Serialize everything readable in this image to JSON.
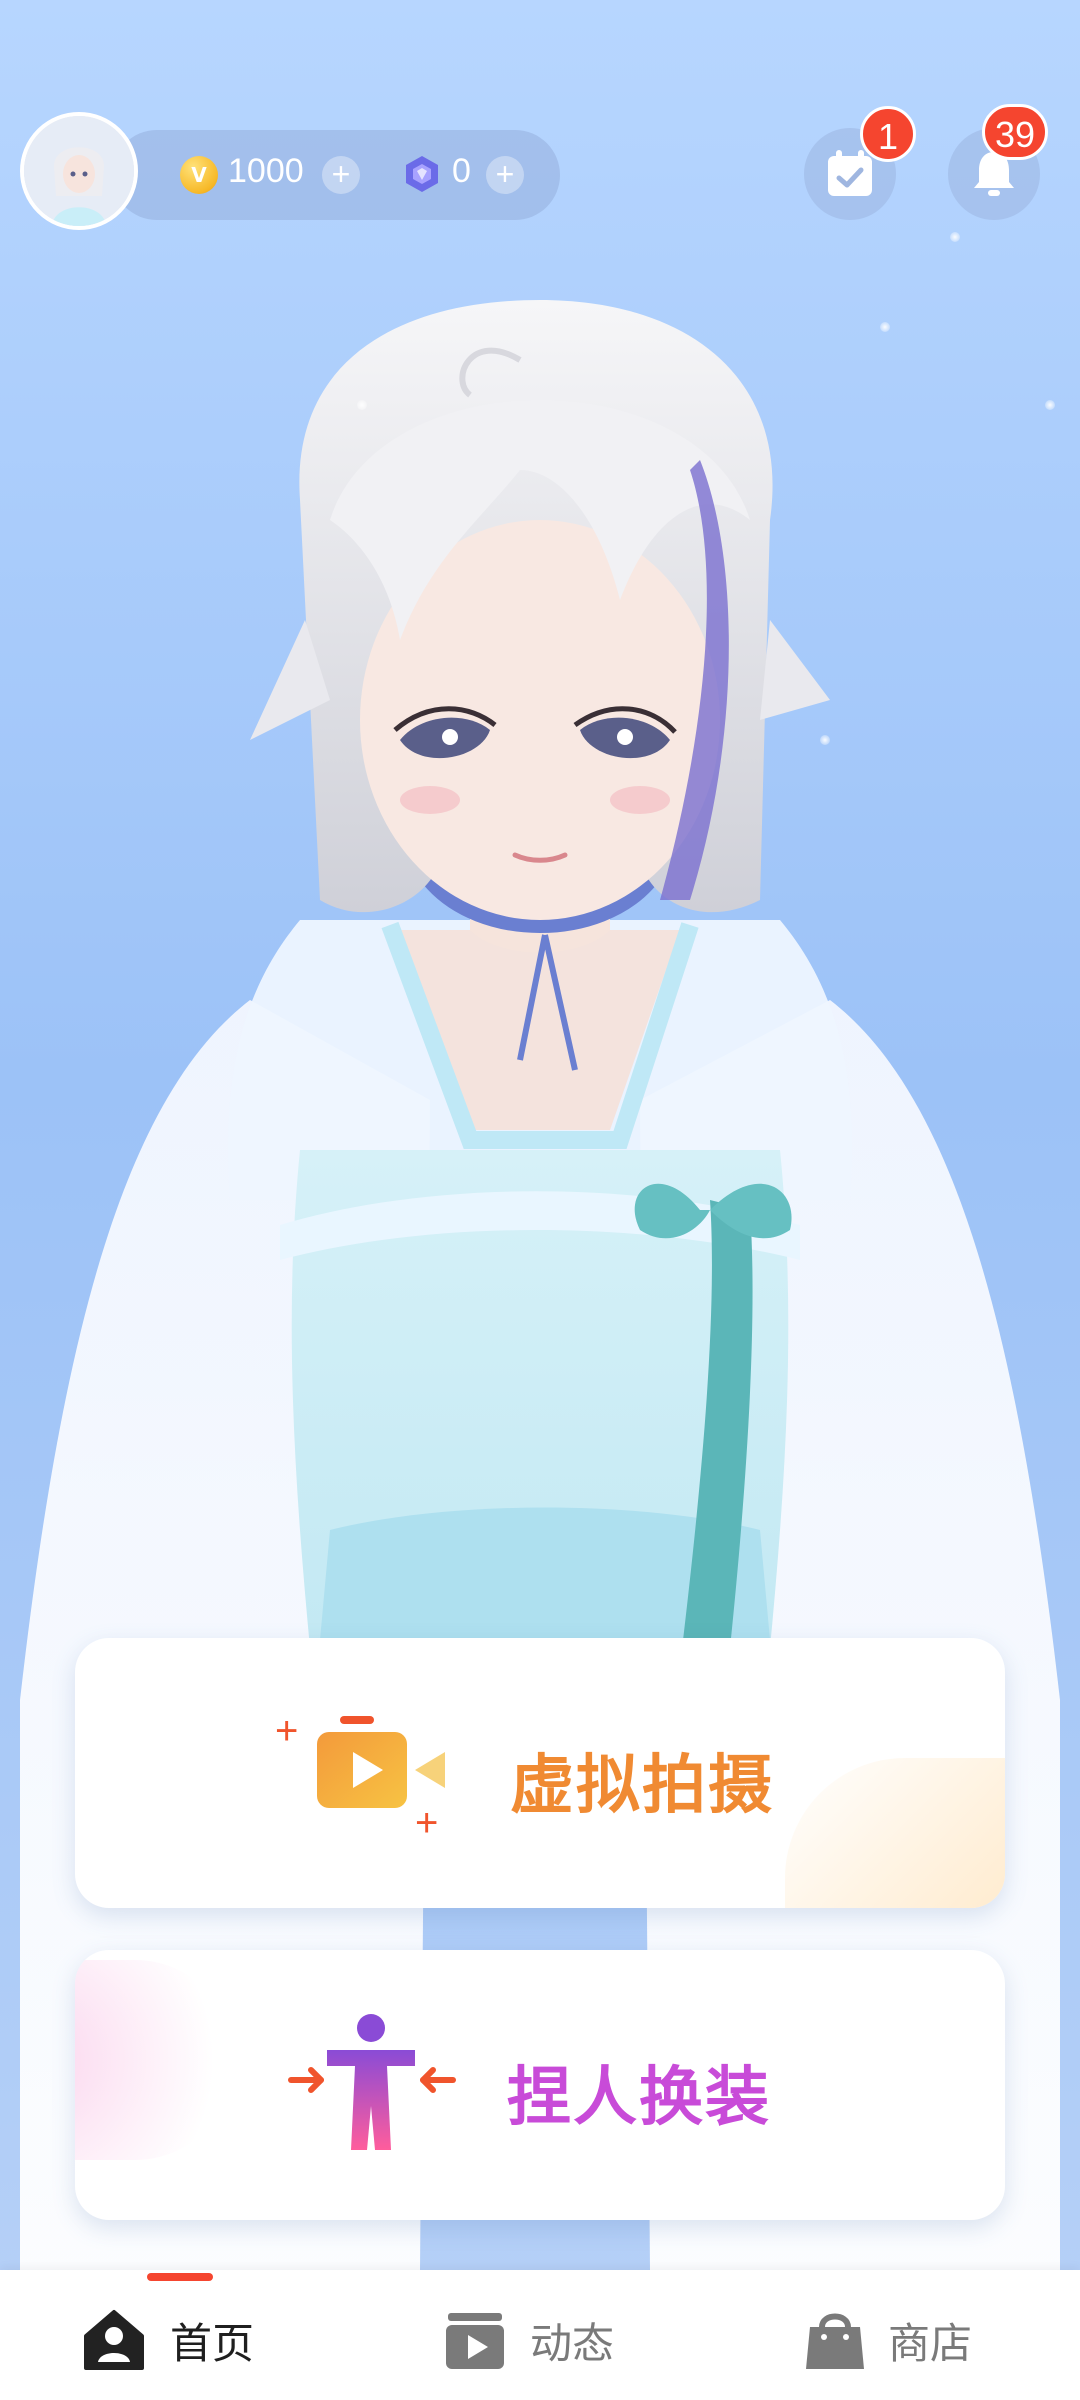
{
  "header": {
    "coins": "1000",
    "gems": "0",
    "checkin_badge": "1",
    "notification_badge": "39",
    "icons": {
      "avatar": "avatar",
      "coin": "coin-icon",
      "gem": "gem-icon",
      "add": "plus-icon",
      "checkin": "calendar-check-icon",
      "notification": "bell-icon"
    }
  },
  "cards": [
    {
      "id": "virtual-shoot",
      "label": "虚拟拍摄",
      "icon": "video-camera-icon",
      "color": "#f08a32"
    },
    {
      "id": "customize",
      "label": "捏人换装",
      "icon": "person-arrows-icon",
      "color": "#c84bd8"
    }
  ],
  "bottom_nav": {
    "items": [
      {
        "label": "首页",
        "icon": "home-user-icon",
        "active": true
      },
      {
        "label": "动态",
        "icon": "video-feed-icon",
        "active": false
      },
      {
        "label": "商店",
        "icon": "shopping-bag-icon",
        "active": false
      }
    ],
    "accent": "#f5452f"
  }
}
